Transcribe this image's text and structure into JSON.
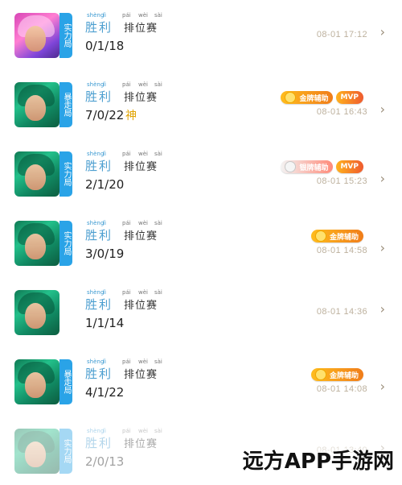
{
  "page": {
    "watermark": "远方APP手游网",
    "colors": {
      "blue_label": "#2aa3e7",
      "title_blue": "#4d9fd0",
      "time_gray": "#bdb19e",
      "badge_gold": "#f07d1a",
      "badge_red": "#ef5b2f"
    }
  },
  "rows": [
    {
      "avatar": "pink-hair-hero-avatar",
      "tag": "实力局",
      "pinyin": [
        "shèng",
        "lì",
        "pái",
        "wèi",
        "sài"
      ],
      "title_main": "胜利",
      "title_rank": "排位赛",
      "kda": "0/1/18",
      "kda_icon": "",
      "badges": [],
      "time": "08-01 17:12",
      "chevron": "›"
    },
    {
      "avatar": "green-hair-hero-avatar",
      "tag": "暴走局",
      "pinyin": [
        "shèng",
        "lì",
        "pái",
        "wèi",
        "sài"
      ],
      "title_main": "胜利",
      "title_rank": "排位赛",
      "kda": "7/0/22",
      "kda_icon": "神",
      "badges": [
        {
          "icon": "gold-medal-icon",
          "label": "金牌辅助",
          "style": "gold"
        },
        {
          "icon": "mvp-icon",
          "label": "MVP",
          "style": "mvp"
        }
      ],
      "time": "08-01 16:43",
      "chevron": "›"
    },
    {
      "avatar": "green-hair-hero-avatar",
      "tag": "实力局",
      "pinyin": [
        "shèng",
        "lì",
        "pái",
        "wèi",
        "sài"
      ],
      "title_main": "胜利",
      "title_rank": "排位赛",
      "kda": "2/1/20",
      "kda_icon": "",
      "badges": [
        {
          "icon": "silver-medal-icon",
          "label": "银牌辅助",
          "style": "silver"
        },
        {
          "icon": "mvp-icon",
          "label": "MVP",
          "style": "mvp"
        }
      ],
      "time": "08-01 15:23",
      "chevron": "›"
    },
    {
      "avatar": "green-hair-hero-avatar",
      "tag": "实力局",
      "pinyin": [
        "shèng",
        "lì",
        "pái",
        "wèi",
        "sài"
      ],
      "title_main": "胜利",
      "title_rank": "排位赛",
      "kda": "3/0/19",
      "kda_icon": "",
      "badges": [
        {
          "icon": "gold-medal-icon",
          "label": "金牌辅助",
          "style": "gold"
        }
      ],
      "time": "08-01 14:58",
      "chevron": "›"
    },
    {
      "avatar": "green-hair-hero-avatar",
      "tag": "",
      "pinyin": [
        "shèng",
        "lì",
        "pái",
        "wèi",
        "sài"
      ],
      "title_main": "胜利",
      "title_rank": "排位赛",
      "kda": "1/1/14",
      "kda_icon": "",
      "badges": [],
      "time": "08-01 14:36",
      "chevron": "›"
    },
    {
      "avatar": "green-hair-hero-avatar",
      "tag": "暴走局",
      "pinyin": [
        "shèng",
        "lì",
        "pái",
        "wèi",
        "sài"
      ],
      "title_main": "胜利",
      "title_rank": "排位赛",
      "kda": "4/1/22",
      "kda_icon": "",
      "badges": [
        {
          "icon": "gold-medal-icon",
          "label": "金牌辅助",
          "style": "gold"
        }
      ],
      "time": "08-01 14:08",
      "chevron": "›"
    },
    {
      "avatar": "green-hair-hero-avatar",
      "tag": "实力局",
      "pinyin": [
        "shèng",
        "lì",
        "pái",
        "wèi",
        "sài"
      ],
      "title_main": "胜利",
      "title_rank": "排位赛",
      "kda": "2/0/13",
      "kda_icon": "",
      "badges": [],
      "time": "08-01 13:40",
      "chevron": "›"
    }
  ]
}
